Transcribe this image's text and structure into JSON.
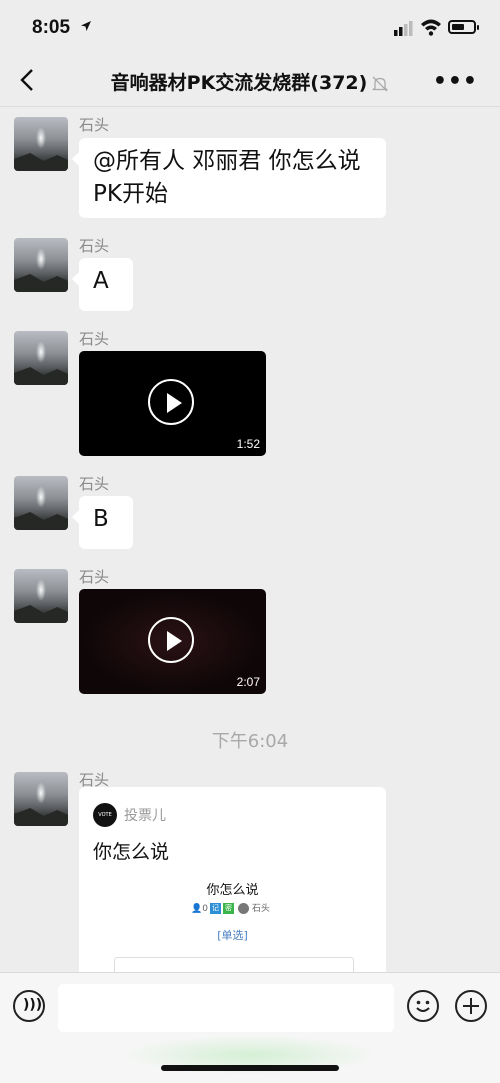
{
  "status_bar": {
    "time": "8:05",
    "location_icon": "location-arrow-icon",
    "signal_icon": "cellular-signal-icon",
    "wifi_icon": "wifi-icon",
    "battery_icon": "battery-icon"
  },
  "header": {
    "back_icon": "back-chevron-icon",
    "title": "音响器材PK交流发烧群(372)",
    "mute_icon": "bell-muted-icon",
    "more_icon": "more-dots-icon"
  },
  "messages": [
    {
      "sender": "石头",
      "type": "text",
      "text_line1": "@所有人 邓丽君 你怎么说",
      "text_line2": "PK开始"
    },
    {
      "sender": "石头",
      "type": "text",
      "text": "A"
    },
    {
      "sender": "石头",
      "type": "video",
      "duration": "1:52"
    },
    {
      "sender": "石头",
      "type": "text",
      "text": "B"
    },
    {
      "sender": "石头",
      "type": "video",
      "duration": "2:07"
    }
  ],
  "timestamp": "下午6:04",
  "vote_message": {
    "sender": "石头",
    "source_logo": "VOTE",
    "source_name": "投票儿",
    "title": "你怎么说",
    "preview_title": "你怎么说",
    "participants": "0",
    "tag1": "记",
    "tag2": "密",
    "creator": "石头",
    "vote_type": "[单选]"
  },
  "input_bar": {
    "voice_icon": "voice-input-icon",
    "emoji_icon": "emoji-icon",
    "plus_icon": "plus-circle-icon",
    "placeholder": ""
  }
}
